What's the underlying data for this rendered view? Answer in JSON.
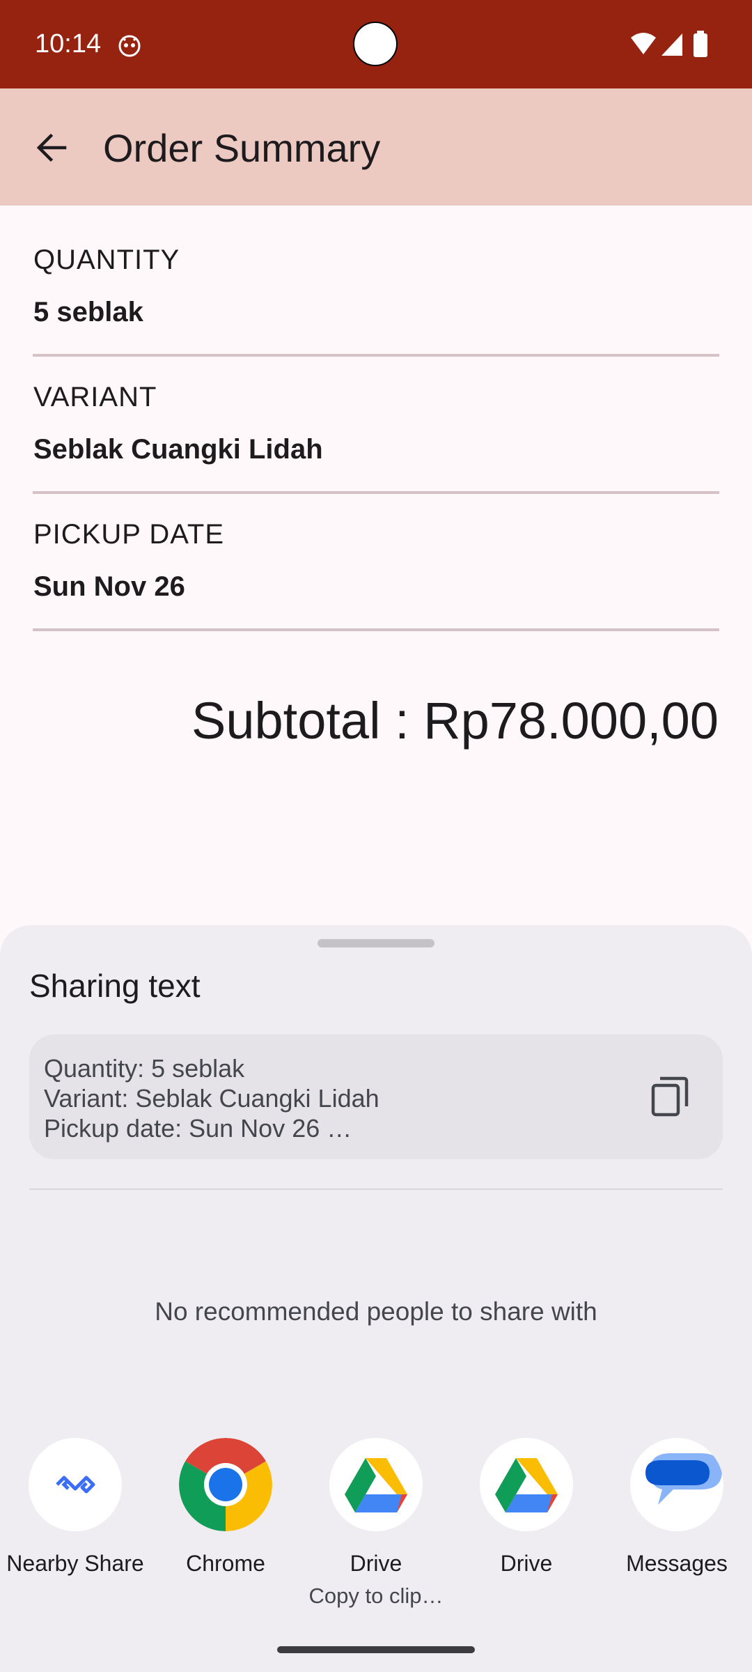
{
  "status_bar": {
    "time": "10:14",
    "background": "#962210",
    "icons": [
      "app-notification-icon",
      "wifi-icon",
      "signal-icon",
      "battery-icon"
    ]
  },
  "app_bar": {
    "title": "Order Summary",
    "back_icon": "arrow-back-icon",
    "background": "#ecc9c1"
  },
  "summary": {
    "quantity": {
      "label": "QUANTITY",
      "value": "5 seblak"
    },
    "variant": {
      "label": "VARIANT",
      "value": "Seblak Cuangki Lidah"
    },
    "pickup_date": {
      "label": "PICKUP DATE",
      "value": "Sun Nov 26"
    },
    "subtotal": "Subtotal : Rp78.000,00"
  },
  "share_sheet": {
    "title": "Sharing text",
    "preview_lines": [
      "Quantity: 5 seblak",
      "Variant: Seblak Cuangki Lidah",
      "Pickup date: Sun Nov 26 …"
    ],
    "copy_icon": "copy-icon",
    "no_recommendations": "No recommended people to share with",
    "targets": [
      {
        "label": "Nearby Share",
        "sublabel": "",
        "icon": "nearby-share-icon"
      },
      {
        "label": "Chrome",
        "sublabel": "",
        "icon": "chrome-icon"
      },
      {
        "label": "Drive",
        "sublabel": "Copy to clip…",
        "icon": "drive-icon"
      },
      {
        "label": "Drive",
        "sublabel": "",
        "icon": "drive-icon"
      },
      {
        "label": "Messages",
        "sublabel": "",
        "icon": "messages-icon"
      }
    ]
  }
}
